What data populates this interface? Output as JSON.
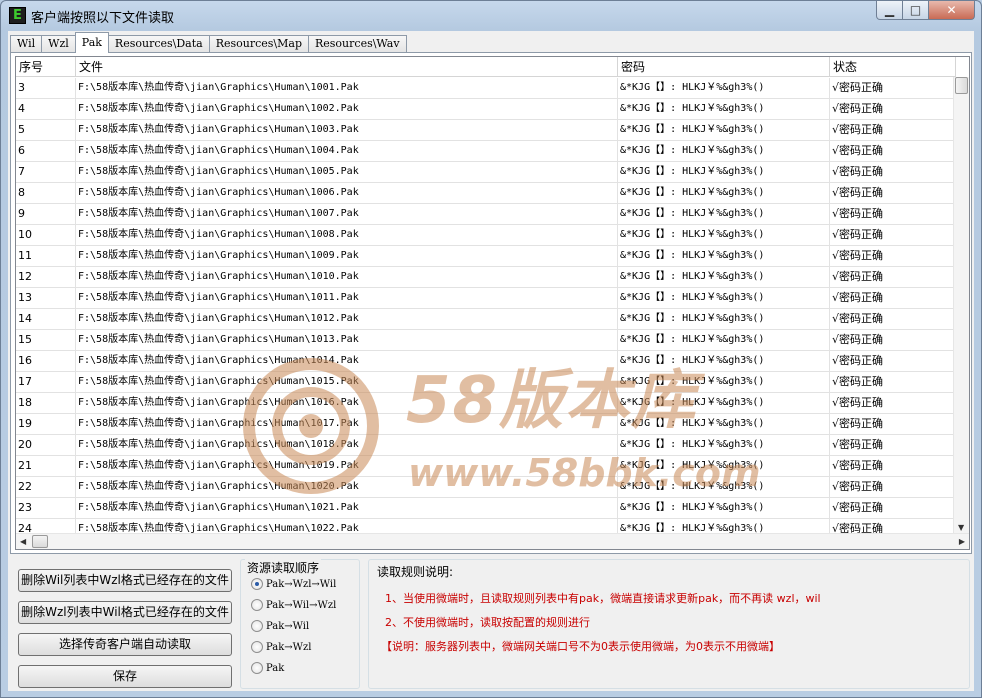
{
  "window": {
    "title": "客户端按照以下文件读取",
    "icon_letter": "E",
    "min_glyph": "▁",
    "max_glyph": "□",
    "close_glyph": "✕"
  },
  "tabs": [
    "Wil",
    "Wzl",
    "Pak",
    "Resources\\Data",
    "Resources\\Map",
    "Resources\\Wav"
  ],
  "active_tab": "Pak",
  "table": {
    "columns": [
      "序号",
      "文件",
      "密码",
      "状态"
    ],
    "rows": [
      {
        "num": "3",
        "file": "F:\\58版本库\\热血传奇\\jian\\Graphics\\Human\\1001.Pak",
        "password": "&*KJG【】: HLKJ￥%&gh3%()",
        "status": "√密码正确"
      },
      {
        "num": "4",
        "file": "F:\\58版本库\\热血传奇\\jian\\Graphics\\Human\\1002.Pak",
        "password": "&*KJG【】: HLKJ￥%&gh3%()",
        "status": "√密码正确"
      },
      {
        "num": "5",
        "file": "F:\\58版本库\\热血传奇\\jian\\Graphics\\Human\\1003.Pak",
        "password": "&*KJG【】: HLKJ￥%&gh3%()",
        "status": "√密码正确"
      },
      {
        "num": "6",
        "file": "F:\\58版本库\\热血传奇\\jian\\Graphics\\Human\\1004.Pak",
        "password": "&*KJG【】: HLKJ￥%&gh3%()",
        "status": "√密码正确"
      },
      {
        "num": "7",
        "file": "F:\\58版本库\\热血传奇\\jian\\Graphics\\Human\\1005.Pak",
        "password": "&*KJG【】: HLKJ￥%&gh3%()",
        "status": "√密码正确"
      },
      {
        "num": "8",
        "file": "F:\\58版本库\\热血传奇\\jian\\Graphics\\Human\\1006.Pak",
        "password": "&*KJG【】: HLKJ￥%&gh3%()",
        "status": "√密码正确"
      },
      {
        "num": "9",
        "file": "F:\\58版本库\\热血传奇\\jian\\Graphics\\Human\\1007.Pak",
        "password": "&*KJG【】: HLKJ￥%&gh3%()",
        "status": "√密码正确"
      },
      {
        "num": "10",
        "file": "F:\\58版本库\\热血传奇\\jian\\Graphics\\Human\\1008.Pak",
        "password": "&*KJG【】: HLKJ￥%&gh3%()",
        "status": "√密码正确"
      },
      {
        "num": "11",
        "file": "F:\\58版本库\\热血传奇\\jian\\Graphics\\Human\\1009.Pak",
        "password": "&*KJG【】: HLKJ￥%&gh3%()",
        "status": "√密码正确"
      },
      {
        "num": "12",
        "file": "F:\\58版本库\\热血传奇\\jian\\Graphics\\Human\\1010.Pak",
        "password": "&*KJG【】: HLKJ￥%&gh3%()",
        "status": "√密码正确"
      },
      {
        "num": "13",
        "file": "F:\\58版本库\\热血传奇\\jian\\Graphics\\Human\\1011.Pak",
        "password": "&*KJG【】: HLKJ￥%&gh3%()",
        "status": "√密码正确"
      },
      {
        "num": "14",
        "file": "F:\\58版本库\\热血传奇\\jian\\Graphics\\Human\\1012.Pak",
        "password": "&*KJG【】: HLKJ￥%&gh3%()",
        "status": "√密码正确"
      },
      {
        "num": "15",
        "file": "F:\\58版本库\\热血传奇\\jian\\Graphics\\Human\\1013.Pak",
        "password": "&*KJG【】: HLKJ￥%&gh3%()",
        "status": "√密码正确"
      },
      {
        "num": "16",
        "file": "F:\\58版本库\\热血传奇\\jian\\Graphics\\Human\\1014.Pak",
        "password": "&*KJG【】: HLKJ￥%&gh3%()",
        "status": "√密码正确"
      },
      {
        "num": "17",
        "file": "F:\\58版本库\\热血传奇\\jian\\Graphics\\Human\\1015.Pak",
        "password": "&*KJG【】: HLKJ￥%&gh3%()",
        "status": "√密码正确"
      },
      {
        "num": "18",
        "file": "F:\\58版本库\\热血传奇\\jian\\Graphics\\Human\\1016.Pak",
        "password": "&*KJG【】: HLKJ￥%&gh3%()",
        "status": "√密码正确"
      },
      {
        "num": "19",
        "file": "F:\\58版本库\\热血传奇\\jian\\Graphics\\Human\\1017.Pak",
        "password": "&*KJG【】: HLKJ￥%&gh3%()",
        "status": "√密码正确"
      },
      {
        "num": "20",
        "file": "F:\\58版本库\\热血传奇\\jian\\Graphics\\Human\\1018.Pak",
        "password": "&*KJG【】: HLKJ￥%&gh3%()",
        "status": "√密码正确"
      },
      {
        "num": "21",
        "file": "F:\\58版本库\\热血传奇\\jian\\Graphics\\Human\\1019.Pak",
        "password": "&*KJG【】: HLKJ￥%&gh3%()",
        "status": "√密码正确"
      },
      {
        "num": "22",
        "file": "F:\\58版本库\\热血传奇\\jian\\Graphics\\Human\\1020.Pak",
        "password": "&*KJG【】: HLKJ￥%&gh3%()",
        "status": "√密码正确"
      },
      {
        "num": "23",
        "file": "F:\\58版本库\\热血传奇\\jian\\Graphics\\Human\\1021.Pak",
        "password": "&*KJG【】: HLKJ￥%&gh3%()",
        "status": "√密码正确"
      },
      {
        "num": "24",
        "file": "F:\\58版本库\\热血传奇\\jian\\Graphics\\Human\\1022.Pak",
        "password": "&*KJG【】: HLKJ￥%&gh3%()",
        "status": "√密码正确"
      }
    ]
  },
  "buttons": {
    "delete_wil": "删除Wil列表中Wzl格式已经存在的文件",
    "delete_wzl": "删除Wzl列表中Wil格式已经存在的文件",
    "auto_read": "选择传奇客户端自动读取",
    "save": "保存"
  },
  "read_order": {
    "title": "资源读取顺序",
    "options": [
      "Pak→Wzl→Wil",
      "Pak→Wil→Wzl",
      "Pak→Wil",
      "Pak→Wzl",
      "Pak"
    ],
    "selected": "Pak→Wzl→Wil"
  },
  "rules": {
    "title": "读取规则说明:",
    "lines": [
      "1、当使用微端时，且读取规则列表中有pak，微端直接请求更新pak，而不再读 wzl，wil",
      "2、不使用微端时，读取按配置的规则进行",
      "【说明：服务器列表中，微端网关端口号不为0表示使用微端，为0表示不用微端】"
    ],
    "color": "#c80000"
  },
  "watermark": {
    "text": "58版本库",
    "url": "www.58bbk.com"
  }
}
